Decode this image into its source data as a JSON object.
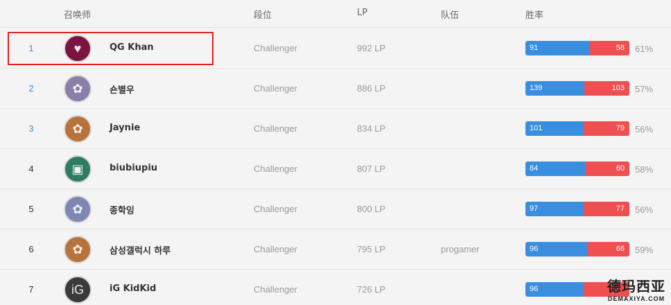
{
  "header": {
    "summoner": "召唤师",
    "tier": "段位",
    "lp": "LP",
    "team": "队伍",
    "winrate": "胜率"
  },
  "rows": [
    {
      "rank": "1",
      "name": "QG Khan",
      "tier": "Challenger",
      "lp": "992 LP",
      "team": "",
      "wins": "91",
      "losses": "58",
      "pct": "61%",
      "avatar_color": "#7a1440",
      "icon": "avatar-heart-icon"
    },
    {
      "rank": "2",
      "name": "숀별우",
      "tier": "Challenger",
      "lp": "886 LP",
      "team": "",
      "wins": "139",
      "losses": "103",
      "pct": "57%",
      "avatar_color": "#8a7fa8",
      "icon": "avatar-poro-icon"
    },
    {
      "rank": "3",
      "name": "Jaynie",
      "tier": "Challenger",
      "lp": "834 LP",
      "team": "",
      "wins": "101",
      "losses": "79",
      "pct": "56%",
      "avatar_color": "#b8733c",
      "icon": "avatar-poro-icon"
    },
    {
      "rank": "4",
      "name": "biubiupiu",
      "tier": "Challenger",
      "lp": "807 LP",
      "team": "",
      "wins": "84",
      "losses": "60",
      "pct": "58%",
      "avatar_color": "#2e7c63",
      "icon": "avatar-chest-icon"
    },
    {
      "rank": "5",
      "name": "종학잉",
      "tier": "Challenger",
      "lp": "800 LP",
      "team": "",
      "wins": "97",
      "losses": "77",
      "pct": "56%",
      "avatar_color": "#7e86b4",
      "icon": "avatar-poro-icon"
    },
    {
      "rank": "6",
      "name": "삼성갤럭시 하루",
      "tier": "Challenger",
      "lp": "795 LP",
      "team": "progamer",
      "wins": "96",
      "losses": "66",
      "pct": "59%",
      "avatar_color": "#b8733c",
      "icon": "avatar-poro-icon"
    },
    {
      "rank": "7",
      "name": "iG KidKid",
      "tier": "Challenger",
      "lp": "726 LP",
      "team": "",
      "wins": "96",
      "losses": "",
      "pct": "",
      "avatar_color": "#3a3a3a",
      "icon": "avatar-ig-logo-icon"
    }
  ],
  "winrate_fraction": [
    "0.61",
    "0.57",
    "0.56",
    "0.58",
    "0.56",
    "0.59",
    "0.56"
  ],
  "watermark": {
    "main": "德玛西亚",
    "sub": "DEMAXIYA.COM"
  },
  "colors": {
    "win": "#3a8ee0",
    "loss": "#ef4f51",
    "rank_link": "#3b8fd9",
    "highlight": "#e0221c"
  }
}
